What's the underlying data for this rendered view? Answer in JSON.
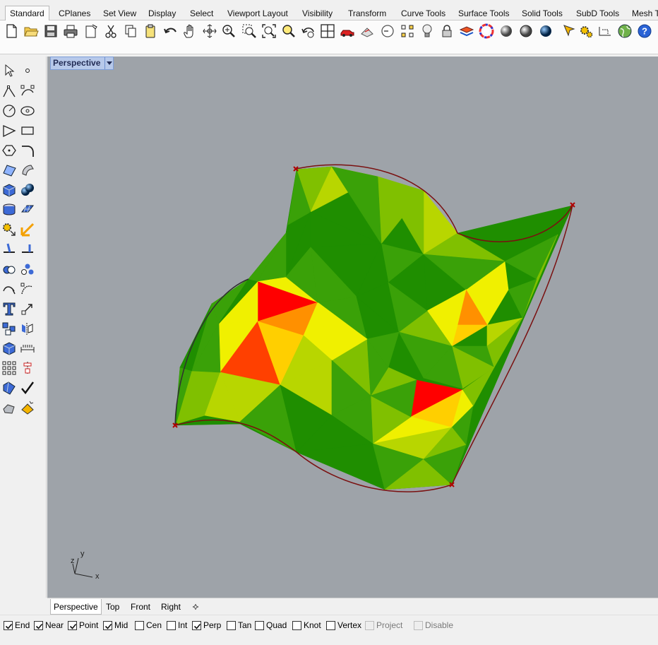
{
  "menu_tabs": [
    {
      "label": "Standard",
      "active": true
    },
    {
      "label": "CPlanes"
    },
    {
      "label": "Set View"
    },
    {
      "label": "Display"
    },
    {
      "label": "Select"
    },
    {
      "label": "Viewport Layout"
    },
    {
      "label": "Visibility"
    },
    {
      "label": "Transform"
    },
    {
      "label": "Curve Tools"
    },
    {
      "label": "Surface Tools"
    },
    {
      "label": "Solid Tools"
    },
    {
      "label": "SubD Tools"
    },
    {
      "label": "Mesh T"
    }
  ],
  "toolbar_icons": [
    "new-file-icon",
    "open-folder-icon",
    "save-icon",
    "print-icon",
    "import-icon",
    "cut-icon",
    "copy-icon",
    "paste-icon",
    "undo-icon",
    "pan-hand-icon",
    "rotate-view-icon",
    "zoom-icon",
    "zoom-window-icon",
    "zoom-extents-icon",
    "zoom-selected-icon",
    "undo-view-icon",
    "four-viewports-icon",
    "car-icon",
    "properties-icon",
    "hide-icon",
    "points-on-icon",
    "bulb-icon",
    "lock-icon",
    "layer-icon",
    "color-wheel-icon",
    "shaded-sphere-icon",
    "render-sphere-icon",
    "blue-sphere-icon",
    "flag-cursor-icon",
    "gear-options-icon",
    "dimension-icon",
    "globe-icon",
    "help-icon"
  ],
  "sidebar_icons": [
    "select-arrow-icon",
    "point-icon",
    "polyline-icon",
    "curve-icon",
    "circle-icon",
    "ellipse-icon",
    "arc-icon",
    "rectangle-icon",
    "polygon-icon",
    "fillet-curve-icon",
    "surface-corner-icon",
    "extrude-surface-icon",
    "box-solid-icon",
    "sphere-solid-icon",
    "cylinder-solid-icon",
    "mesh-plane-icon",
    "gear-move-icon",
    "explode-icon",
    "split-icon",
    "trim-icon",
    "boolean-icon",
    "group-icon",
    "edit-points-icon",
    "rebuild-icon",
    "text-icon",
    "move-gumball-icon",
    "array-icon",
    "mirror-icon",
    "block-icon",
    "dimension-ruler-icon",
    "grid-array-icon",
    "align-icon",
    "analyze-icon",
    "check-icon",
    "render-mesh-icon",
    "material-icon"
  ],
  "viewport": {
    "title": "Perspective",
    "background": "#9ea3a9",
    "axes": {
      "x": "x",
      "y": "y",
      "z": "z"
    },
    "palette": {
      "dark_green": "#1f8e00",
      "green": "#3aa108",
      "lime": "#80c000",
      "yellow_green": "#b8d600",
      "yellow": "#f0f000",
      "gold": "#ffcf00",
      "orange": "#ff9000",
      "red_orange": "#ff4000",
      "red": "#ff0000"
    }
  },
  "view_tabs": [
    {
      "label": "Perspective",
      "active": true
    },
    {
      "label": "Top"
    },
    {
      "label": "Front"
    },
    {
      "label": "Right"
    }
  ],
  "osnaps": [
    {
      "label": "End",
      "checked": true
    },
    {
      "label": "Near",
      "checked": true
    },
    {
      "label": "Point",
      "checked": true
    },
    {
      "label": "Mid",
      "checked": true
    },
    {
      "label": "Cen",
      "checked": false
    },
    {
      "label": "Int",
      "checked": false
    },
    {
      "label": "Perp",
      "checked": true
    },
    {
      "label": "Tan",
      "checked": false
    },
    {
      "label": "Quad",
      "checked": false
    },
    {
      "label": "Knot",
      "checked": false
    },
    {
      "label": "Vertex",
      "checked": false
    },
    {
      "label": "Project",
      "checked": false,
      "disabled": true
    },
    {
      "label": "Disable",
      "checked": false,
      "disabled": true
    }
  ]
}
